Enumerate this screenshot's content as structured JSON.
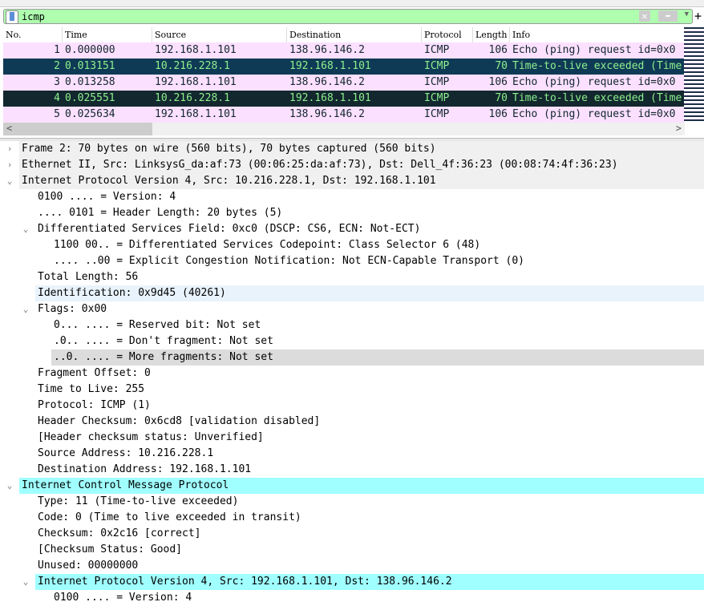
{
  "filter": {
    "value": "icmp",
    "clear_icon": "close-icon",
    "apply_icon": "arrow-right-icon",
    "dropdown_icon": "chevron-down-icon",
    "add_label": "+"
  },
  "columns": [
    "No.",
    "Time",
    "Source",
    "Destination",
    "Protocol",
    "Length",
    "Info"
  ],
  "packets": [
    {
      "no": "1",
      "time": "0.000000",
      "src": "192.168.1.101",
      "dst": "138.96.146.2",
      "proto": "ICMP",
      "len": "106",
      "info": "Echo (ping) request  id=0x0"
    },
    {
      "no": "2",
      "time": "0.013151",
      "src": "10.216.228.1",
      "dst": "192.168.1.101",
      "proto": "ICMP",
      "len": "70",
      "info": "Time-to-live exceeded (Time"
    },
    {
      "no": "3",
      "time": "0.013258",
      "src": "192.168.1.101",
      "dst": "138.96.146.2",
      "proto": "ICMP",
      "len": "106",
      "info": "Echo (ping) request  id=0x0"
    },
    {
      "no": "4",
      "time": "0.025551",
      "src": "10.216.228.1",
      "dst": "192.168.1.101",
      "proto": "ICMP",
      "len": "70",
      "info": "Time-to-live exceeded (Time"
    },
    {
      "no": "5",
      "time": "0.025634",
      "src": "192.168.1.101",
      "dst": "138.96.146.2",
      "proto": "ICMP",
      "len": "106",
      "info": "Echo (ping) request  id=0x0"
    }
  ],
  "row_colors": {
    "echo": "#fce0ff",
    "selected": "#0f3a55",
    "ttl": "#12272e",
    "ttl_text": "#8ef08e",
    "filter_bg": "#afffaf",
    "icmp_highlight": "#a0ffff"
  },
  "tree": [
    {
      "text": "Frame 2: 70 bytes on wire (560 bits), 70 bytes captured (560 bits)",
      "level": 0,
      "arrow": "collapsed",
      "style": "g"
    },
    {
      "text": "Ethernet II, Src: LinksysG_da:af:73 (00:06:25:da:af:73), Dst: Dell_4f:36:23 (00:08:74:4f:36:23)",
      "level": 0,
      "arrow": "collapsed",
      "style": "g"
    },
    {
      "text": "Internet Protocol Version 4, Src: 10.216.228.1, Dst: 192.168.1.101",
      "level": 0,
      "arrow": "expanded",
      "style": "g"
    },
    {
      "text": "0100 .... = Version: 4",
      "level": 1
    },
    {
      "text": ".... 0101 = Header Length: 20 bytes (5)",
      "level": 1
    },
    {
      "text": "Differentiated Services Field: 0xc0 (DSCP: CS6, ECN: Not-ECT)",
      "level": 1,
      "arrow": "expanded"
    },
    {
      "text": "1100 00.. = Differentiated Services Codepoint: Class Selector 6 (48)",
      "level": 2
    },
    {
      "text": ".... ..00 = Explicit Congestion Notification: Not ECN-Capable Transport (0)",
      "level": 2
    },
    {
      "text": "Total Length: 56",
      "level": 1
    },
    {
      "text": "Identification: 0x9d45 (40261)",
      "level": 1,
      "style": "hl"
    },
    {
      "text": "Flags: 0x00",
      "level": 1,
      "arrow": "expanded"
    },
    {
      "text": "0... .... = Reserved bit: Not set",
      "level": 2
    },
    {
      "text": ".0.. .... = Don't fragment: Not set",
      "level": 2
    },
    {
      "text": "..0. .... = More fragments: Not set",
      "level": 2,
      "style": "gr"
    },
    {
      "text": "Fragment Offset: 0",
      "level": 1
    },
    {
      "text": "Time to Live: 255",
      "level": 1
    },
    {
      "text": "Protocol: ICMP (1)",
      "level": 1
    },
    {
      "text": "Header Checksum: 0x6cd8 [validation disabled]",
      "level": 1
    },
    {
      "text": "[Header checksum status: Unverified]",
      "level": 1
    },
    {
      "text": "Source Address: 10.216.228.1",
      "level": 1
    },
    {
      "text": "Destination Address: 192.168.1.101",
      "level": 1
    },
    {
      "text": "Internet Control Message Protocol",
      "level": 0,
      "arrow": "expanded",
      "style": "cy"
    },
    {
      "text": "Type: 11 (Time-to-live exceeded)",
      "level": 1
    },
    {
      "text": "Code: 0 (Time to live exceeded in transit)",
      "level": 1
    },
    {
      "text": "Checksum: 0x2c16 [correct]",
      "level": 1
    },
    {
      "text": "[Checksum Status: Good]",
      "level": 1
    },
    {
      "text": "Unused: 00000000",
      "level": 1
    },
    {
      "text": "Internet Protocol Version 4, Src: 192.168.1.101, Dst: 138.96.146.2",
      "level": 1,
      "arrow": "expanded",
      "style": "cy"
    },
    {
      "text": "0100 .... = Version: 4",
      "level": 2
    }
  ]
}
